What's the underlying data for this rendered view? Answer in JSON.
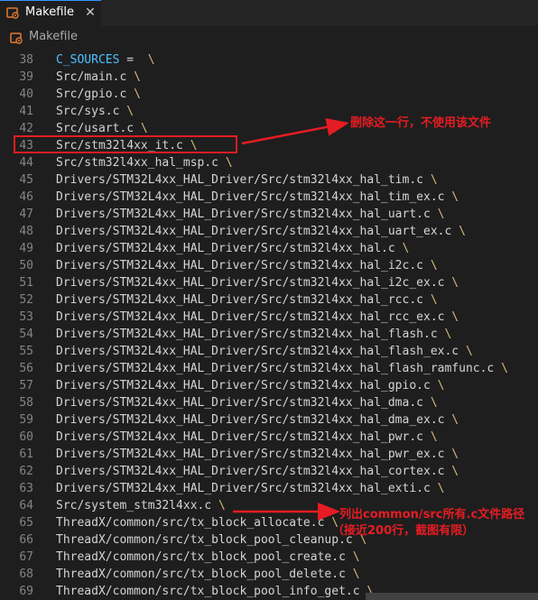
{
  "tab": {
    "icon": "makefile-icon",
    "label": "Makefile",
    "close_glyph": "✕"
  },
  "breadcrumb": {
    "icon": "makefile-icon",
    "label": "Makefile"
  },
  "colors": {
    "accent": "#3794ff",
    "annotation": "#e51c23",
    "variable": "#4fc1ff",
    "backslash": "#d7ba7d"
  },
  "lines": [
    {
      "num": "38",
      "pre": "",
      "var": "C_SOURCES",
      "text": " =  ",
      "bs": "\\"
    },
    {
      "num": "39",
      "pre": "",
      "var": "",
      "text": "Src/main.c ",
      "bs": "\\"
    },
    {
      "num": "40",
      "pre": "",
      "var": "",
      "text": "Src/gpio.c ",
      "bs": "\\"
    },
    {
      "num": "41",
      "pre": "",
      "var": "",
      "text": "Src/sys.c ",
      "bs": "\\"
    },
    {
      "num": "42",
      "pre": "",
      "var": "",
      "text": "Src/usart.c ",
      "bs": "\\"
    },
    {
      "num": "43",
      "pre": "",
      "var": "",
      "text": "Src/stm32l4xx_it.c ",
      "bs": "\\"
    },
    {
      "num": "44",
      "pre": "",
      "var": "",
      "text": "Src/stm32l4xx_hal_msp.c ",
      "bs": "\\"
    },
    {
      "num": "45",
      "pre": "",
      "var": "",
      "text": "Drivers/STM32L4xx_HAL_Driver/Src/stm32l4xx_hal_tim.c ",
      "bs": "\\"
    },
    {
      "num": "46",
      "pre": "",
      "var": "",
      "text": "Drivers/STM32L4xx_HAL_Driver/Src/stm32l4xx_hal_tim_ex.c ",
      "bs": "\\"
    },
    {
      "num": "47",
      "pre": "",
      "var": "",
      "text": "Drivers/STM32L4xx_HAL_Driver/Src/stm32l4xx_hal_uart.c ",
      "bs": "\\"
    },
    {
      "num": "48",
      "pre": "",
      "var": "",
      "text": "Drivers/STM32L4xx_HAL_Driver/Src/stm32l4xx_hal_uart_ex.c ",
      "bs": "\\"
    },
    {
      "num": "49",
      "pre": "",
      "var": "",
      "text": "Drivers/STM32L4xx_HAL_Driver/Src/stm32l4xx_hal.c ",
      "bs": "\\"
    },
    {
      "num": "50",
      "pre": "",
      "var": "",
      "text": "Drivers/STM32L4xx_HAL_Driver/Src/stm32l4xx_hal_i2c.c ",
      "bs": "\\"
    },
    {
      "num": "51",
      "pre": "",
      "var": "",
      "text": "Drivers/STM32L4xx_HAL_Driver/Src/stm32l4xx_hal_i2c_ex.c ",
      "bs": "\\"
    },
    {
      "num": "52",
      "pre": "",
      "var": "",
      "text": "Drivers/STM32L4xx_HAL_Driver/Src/stm32l4xx_hal_rcc.c ",
      "bs": "\\"
    },
    {
      "num": "53",
      "pre": "",
      "var": "",
      "text": "Drivers/STM32L4xx_HAL_Driver/Src/stm32l4xx_hal_rcc_ex.c ",
      "bs": "\\"
    },
    {
      "num": "54",
      "pre": "",
      "var": "",
      "text": "Drivers/STM32L4xx_HAL_Driver/Src/stm32l4xx_hal_flash.c ",
      "bs": "\\"
    },
    {
      "num": "55",
      "pre": "",
      "var": "",
      "text": "Drivers/STM32L4xx_HAL_Driver/Src/stm32l4xx_hal_flash_ex.c ",
      "bs": "\\"
    },
    {
      "num": "56",
      "pre": "",
      "var": "",
      "text": "Drivers/STM32L4xx_HAL_Driver/Src/stm32l4xx_hal_flash_ramfunc.c ",
      "bs": "\\"
    },
    {
      "num": "57",
      "pre": "",
      "var": "",
      "text": "Drivers/STM32L4xx_HAL_Driver/Src/stm32l4xx_hal_gpio.c ",
      "bs": "\\"
    },
    {
      "num": "58",
      "pre": "",
      "var": "",
      "text": "Drivers/STM32L4xx_HAL_Driver/Src/stm32l4xx_hal_dma.c ",
      "bs": "\\"
    },
    {
      "num": "59",
      "pre": "",
      "var": "",
      "text": "Drivers/STM32L4xx_HAL_Driver/Src/stm32l4xx_hal_dma_ex.c ",
      "bs": "\\"
    },
    {
      "num": "60",
      "pre": "",
      "var": "",
      "text": "Drivers/STM32L4xx_HAL_Driver/Src/stm32l4xx_hal_pwr.c ",
      "bs": "\\"
    },
    {
      "num": "61",
      "pre": "",
      "var": "",
      "text": "Drivers/STM32L4xx_HAL_Driver/Src/stm32l4xx_hal_pwr_ex.c ",
      "bs": "\\"
    },
    {
      "num": "62",
      "pre": "",
      "var": "",
      "text": "Drivers/STM32L4xx_HAL_Driver/Src/stm32l4xx_hal_cortex.c ",
      "bs": "\\"
    },
    {
      "num": "63",
      "pre": "",
      "var": "",
      "text": "Drivers/STM32L4xx_HAL_Driver/Src/stm32l4xx_hal_exti.c ",
      "bs": "\\"
    },
    {
      "num": "64",
      "pre": "",
      "var": "",
      "text": "Src/system_stm32l4xx.c ",
      "bs": "\\"
    },
    {
      "num": "65",
      "pre": "",
      "var": "",
      "text": "ThreadX/common/src/tx_block_allocate.c ",
      "bs": "\\"
    },
    {
      "num": "66",
      "pre": "",
      "var": "",
      "text": "ThreadX/common/src/tx_block_pool_cleanup.c ",
      "bs": "\\"
    },
    {
      "num": "67",
      "pre": "",
      "var": "",
      "text": "ThreadX/common/src/tx_block_pool_create.c ",
      "bs": "\\"
    },
    {
      "num": "68",
      "pre": "",
      "var": "",
      "text": "ThreadX/common/src/tx_block_pool_delete.c ",
      "bs": "\\"
    },
    {
      "num": "69",
      "pre": "",
      "var": "",
      "text": "ThreadX/common/src/tx_block_pool_info_get.c ",
      "bs": "\\"
    }
  ],
  "annotations": {
    "delete_line": "删除这一行，不使用该文件",
    "list_sources_line1": "列出common/src所有.c文件路径",
    "list_sources_line2": "（接近200行，截图有限）"
  }
}
